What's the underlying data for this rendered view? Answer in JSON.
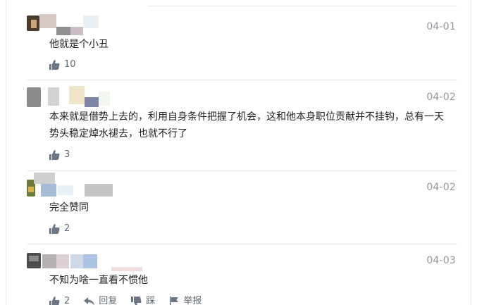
{
  "comments": [
    {
      "date": "04-01",
      "text": "他就是个小丑",
      "likes": "10"
    },
    {
      "date": "04-02",
      "text": "本来就是借势上去的，利用自身条件把握了机会，这和他本身职位贡献并不挂钩，总有一天势头稳定焯水褪去，也就不行了",
      "likes": "3"
    },
    {
      "date": "04-02",
      "text": "完全赞同",
      "likes": "2"
    },
    {
      "date": "04-03",
      "text": "不知为啥一直看不惯他",
      "likes": "2",
      "reply_label": "回复",
      "dislike_label": "踩",
      "report_label": "举报"
    }
  ],
  "icons": {
    "like": "thumbs-up-icon",
    "reply": "reply-arrow-icon",
    "dislike": "thumbs-down-icon",
    "report": "flag-icon"
  },
  "colors": {
    "date": "#8f959c",
    "action": "#606a73",
    "divider": "#ebebeb"
  }
}
